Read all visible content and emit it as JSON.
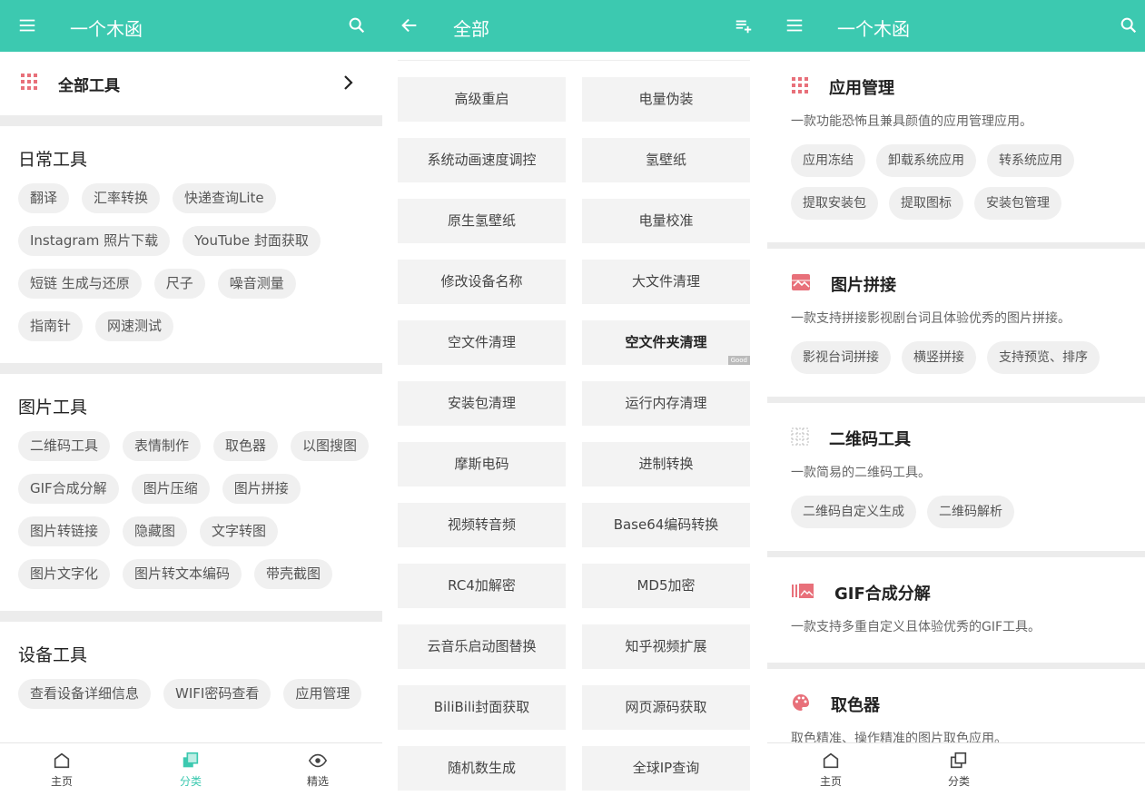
{
  "panel1": {
    "title": "一个木函",
    "all_tools_label": "全部工具",
    "sections": [
      {
        "title": "日常工具",
        "chips": [
          "翻译",
          "汇率转换",
          "快递查询Lite",
          "Instagram 照片下载",
          "YouTube 封面获取",
          "短链 生成与还原",
          "尺子",
          "噪音测量",
          "指南针",
          "网速测试"
        ]
      },
      {
        "title": "图片工具",
        "chips": [
          "二维码工具",
          "表情制作",
          "取色器",
          "以图搜图",
          "GIF合成分解",
          "图片压缩",
          "图片拼接",
          "图片转链接",
          "隐藏图",
          "文字转图",
          "图片文字化",
          "图片转文本编码",
          "带壳截图"
        ]
      },
      {
        "title": "设备工具",
        "chips": [
          "查看设备详细信息",
          "WIFI密码查看",
          "应用管理"
        ]
      }
    ],
    "nav": {
      "home": "主页",
      "category": "分类",
      "featured": "精选"
    }
  },
  "panel2": {
    "title": "全部",
    "tools": [
      "高级重启",
      "电量伪装",
      "系统动画速度调控",
      "氢壁纸",
      "原生氢壁纸",
      "电量校准",
      "修改设备名称",
      "大文件清理",
      "空文件清理",
      "空文件夹清理",
      "安装包清理",
      "运行内存清理",
      "摩斯电码",
      "进制转换",
      "视频转音频",
      "Base64编码转换",
      "RC4加解密",
      "MD5加密",
      "云音乐启动图替换",
      "知乎视频扩展",
      "BiliBili封面获取",
      "网页源码获取",
      "随机数生成",
      "全球IP查询"
    ],
    "good_tag": "Good"
  },
  "panel3": {
    "title": "一个木函",
    "cards": [
      {
        "title": "应用管理",
        "icon": "grid-icon",
        "desc": "一款功能恐怖且兼具颜值的应用管理应用。",
        "chips": [
          "应用冻结",
          "卸载系统应用",
          "转系统应用",
          "提取安装包",
          "提取图标",
          "安装包管理"
        ]
      },
      {
        "title": "图片拼接",
        "icon": "image-collage-icon",
        "desc": "一款支持拼接影视剧台词且体验优秀的图片拼接。",
        "chips": [
          "影视台词拼接",
          "横竖拼接",
          "支持预览、排序"
        ]
      },
      {
        "title": "二维码工具",
        "icon": "qrcode-icon",
        "desc": "一款简易的二维码工具。",
        "chips": [
          "二维码自定义生成",
          "二维码解析"
        ]
      },
      {
        "title": "GIF合成分解",
        "icon": "gif-frames-icon",
        "desc": "一款支持多重自定义且体验优秀的GIF工具。",
        "chips": []
      },
      {
        "title": "取色器",
        "icon": "palette-icon",
        "desc": "取色精准、操作精准的图片取色应用。",
        "chips": []
      }
    ],
    "nav": {
      "home": "主页",
      "category": "分类"
    }
  },
  "colors": {
    "accent": "#3cc9b0",
    "icon_red": "#e8707a"
  }
}
